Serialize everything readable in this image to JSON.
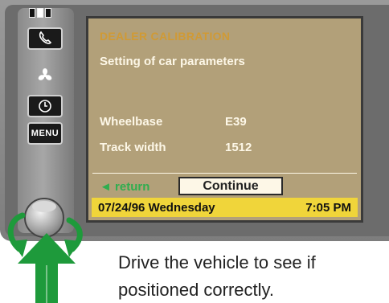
{
  "screen": {
    "title": "DEALER CALIBRATION",
    "subtitle": "Setting of car parameters",
    "params": [
      {
        "label": "Wheelbase",
        "value": "E39"
      },
      {
        "label": "Track width",
        "value": "1512"
      }
    ],
    "return_label": "◄ return",
    "continue_label": "Continue",
    "status": {
      "date": "07/24/96",
      "day": "Wednesday",
      "time": "7:05 PM"
    }
  },
  "side_buttons": {
    "menu_label": "MENU",
    "icons": [
      "phone-icon",
      "fan-icon",
      "clock-icon",
      "menu-button"
    ]
  },
  "caption": {
    "line1": "Drive the vehicle to see if",
    "line2": "positioned correctly."
  },
  "colors": {
    "screen_bg": "#b2a079",
    "title": "#d09a35",
    "text": "#fdf7e7",
    "return": "#2fae4f",
    "status_bar": "#f0d53a",
    "arrow": "#1e9a3b"
  }
}
